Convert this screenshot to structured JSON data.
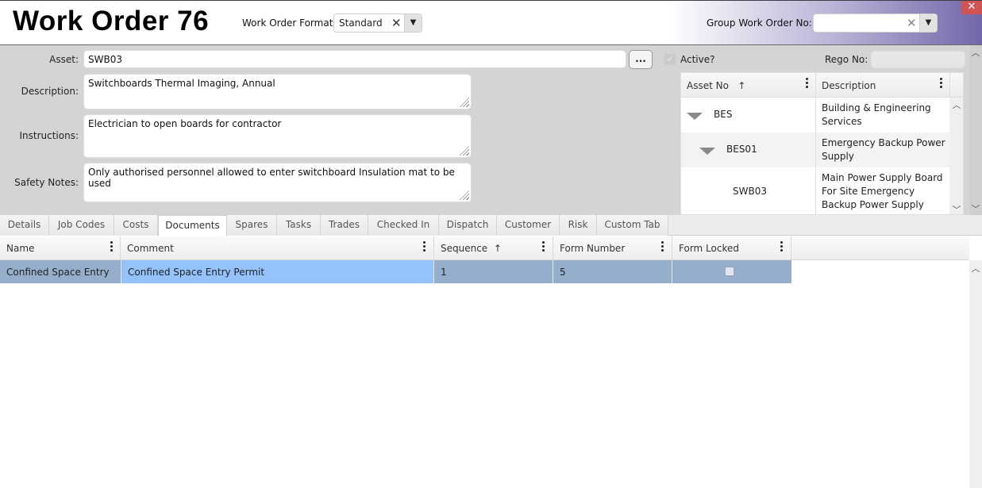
{
  "header": {
    "title": "Work Order 76",
    "format_label": "Work Order Format",
    "format_value": "Standard",
    "group_label": "Group Work Order No:",
    "group_value": "",
    "clear_glyph": "✕",
    "dropdown_glyph": "▼",
    "close_glyph": "✕"
  },
  "form": {
    "asset_label": "Asset:",
    "asset_value": "SWB03",
    "browse_label": "...",
    "description_label": "Description:",
    "description_value": "Switchboards Thermal Imaging, Annual",
    "instructions_label": "Instructions:",
    "instructions_value": "Electrician to open boards for contractor",
    "safety_label": "Safety Notes:",
    "safety_value": "Only authorised personnel allowed to enter switchboard Insulation mat to be used",
    "active_label": "Active?",
    "active_checked": true,
    "rego_label": "Rego No:",
    "rego_value": ""
  },
  "asset_tree": {
    "columns": [
      {
        "label": "Asset No",
        "sort": "↑"
      },
      {
        "label": "Description"
      }
    ],
    "rows": [
      {
        "asset_no": "BES",
        "description": "Building & Engineering Services",
        "level": 0,
        "expanded": true
      },
      {
        "asset_no": "BES01",
        "description": "Emergency Backup Power Supply",
        "level": 1,
        "expanded": true
      },
      {
        "asset_no": "SWB03",
        "description": "Main Power Supply Board For Site Emergency Backup Power Supply",
        "level": 2,
        "expanded": false
      }
    ],
    "desc_lines": [
      [
        "Building & Engineering",
        "Services"
      ],
      [
        "Emergency Backup Power",
        "Supply"
      ],
      [
        "Main Power Supply Board",
        "For Site Emergency",
        "Backup Power Supply"
      ]
    ]
  },
  "tabs": [
    {
      "label": "Details"
    },
    {
      "label": "Job Codes"
    },
    {
      "label": "Costs"
    },
    {
      "label": "Documents",
      "active": true
    },
    {
      "label": "Spares"
    },
    {
      "label": "Tasks"
    },
    {
      "label": "Trades"
    },
    {
      "label": "Checked In"
    },
    {
      "label": "Dispatch"
    },
    {
      "label": "Customer"
    },
    {
      "label": "Risk"
    },
    {
      "label": "Custom Tab"
    }
  ],
  "documents_grid": {
    "columns": [
      {
        "label": "Name"
      },
      {
        "label": "Comment"
      },
      {
        "label": "Sequence",
        "sort": "↑"
      },
      {
        "label": "Form Number"
      },
      {
        "label": "Form Locked"
      }
    ],
    "rows": [
      {
        "name": "Confined Space Entry",
        "comment": "Confined Space Entry Permit",
        "sequence": "1",
        "form_number": "5",
        "form_locked": false
      }
    ]
  },
  "colors": {
    "row_selected": "#94aecb",
    "cell_focused": "#93c2fd",
    "close_button": "#d05454",
    "header_gradient_end": "#7367aa"
  }
}
